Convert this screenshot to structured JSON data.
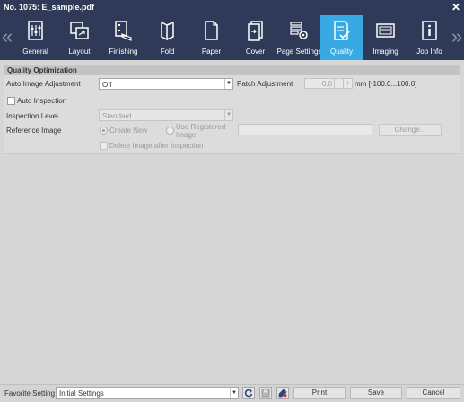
{
  "window": {
    "title": "No. 1075: E_sample.pdf"
  },
  "icons": {
    "close": "close-icon",
    "nav_left": "chevron-left-icon",
    "nav_right": "chevron-right-icon"
  },
  "nav": {
    "left_glyph": "«",
    "right_glyph": "»",
    "close_glyph": "✕"
  },
  "tabs": [
    {
      "label": "General",
      "icon": "general-icon"
    },
    {
      "label": "Layout",
      "icon": "layout-icon"
    },
    {
      "label": "Finishing",
      "icon": "finishing-icon"
    },
    {
      "label": "Fold",
      "icon": "fold-icon"
    },
    {
      "label": "Paper",
      "icon": "paper-icon"
    },
    {
      "label": "Cover",
      "icon": "cover-icon"
    },
    {
      "label": "Page Settings",
      "icon": "page-settings-icon"
    },
    {
      "label": "Quality",
      "icon": "quality-icon",
      "active": true
    },
    {
      "label": "Imaging",
      "icon": "imaging-icon"
    },
    {
      "label": "Job Info",
      "icon": "job-info-icon"
    }
  ],
  "quality": {
    "section_title": "Quality Optimization",
    "auto_image_adjustment": {
      "label": "Auto Image Adjustment",
      "value": "Off"
    },
    "patch_adjustment": {
      "label": "Patch Adjustment",
      "value": "0.0",
      "minus": "-",
      "plus": "+",
      "range": "mm [-100.0...100.0]"
    },
    "auto_inspection": {
      "label": "Auto Inspection",
      "checked": false
    },
    "inspection_level": {
      "label": "Inspection Level",
      "value": "Standard"
    },
    "reference_image": {
      "label": "Reference Image",
      "option_create_new": "Create New",
      "option_use_registered": "Use Registered",
      "option_use_registered_line2": "Image",
      "path_value": "",
      "change_button": "Change..."
    },
    "delete_after_inspection": {
      "label": "Delete Image after Inspection",
      "checked": false
    }
  },
  "footer": {
    "favorite_label": "Favorite Setting",
    "favorite_value": "Initial Settings",
    "print": "Print",
    "save": "Save",
    "cancel": "Cancel"
  },
  "colors": {
    "titlebar": "#2e3a57",
    "active_tab": "#39a9e4",
    "panel": "#d6d6d6"
  }
}
